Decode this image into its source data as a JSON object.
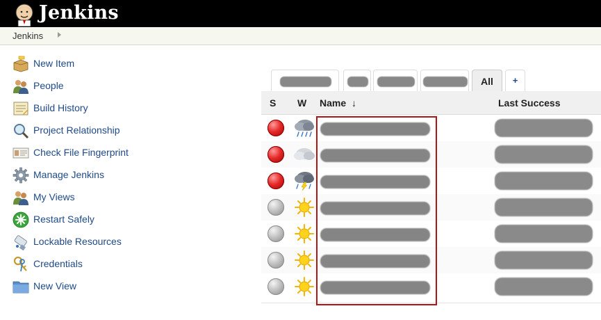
{
  "header": {
    "title": "Jenkins"
  },
  "breadcrumb": {
    "items": [
      "Jenkins"
    ]
  },
  "sidebar": {
    "items": [
      {
        "label": "New Item",
        "icon": "new-item-icon"
      },
      {
        "label": "People",
        "icon": "people-icon"
      },
      {
        "label": "Build History",
        "icon": "build-history-icon"
      },
      {
        "label": "Project Relationship",
        "icon": "magnifier-icon"
      },
      {
        "label": "Check File Fingerprint",
        "icon": "fingerprint-icon"
      },
      {
        "label": "Manage Jenkins",
        "icon": "gear-icon"
      },
      {
        "label": "My Views",
        "icon": "my-views-icon"
      },
      {
        "label": "Restart Safely",
        "icon": "restart-icon"
      },
      {
        "label": "Lockable Resources",
        "icon": "usb-icon"
      },
      {
        "label": "Credentials",
        "icon": "keys-icon"
      },
      {
        "label": "New View",
        "icon": "folder-icon"
      }
    ]
  },
  "tabs": {
    "active_label": "All",
    "add_label": "+"
  },
  "table": {
    "columns": {
      "status": "S",
      "weather": "W",
      "name": "Name",
      "sort_indicator": "↓",
      "last_success": "Last Success"
    },
    "rows": [
      {
        "status": "red",
        "weather": "storm-rain"
      },
      {
        "status": "red",
        "weather": "cloudy"
      },
      {
        "status": "red",
        "weather": "thunderstorm"
      },
      {
        "status": "grey",
        "weather": "sunny"
      },
      {
        "status": "grey",
        "weather": "sunny"
      },
      {
        "status": "grey",
        "weather": "sunny"
      },
      {
        "status": "grey",
        "weather": "sunny"
      }
    ]
  },
  "colors": {
    "link": "#204a87",
    "header_bg": "#000000",
    "highlight_box": "#b01616"
  }
}
